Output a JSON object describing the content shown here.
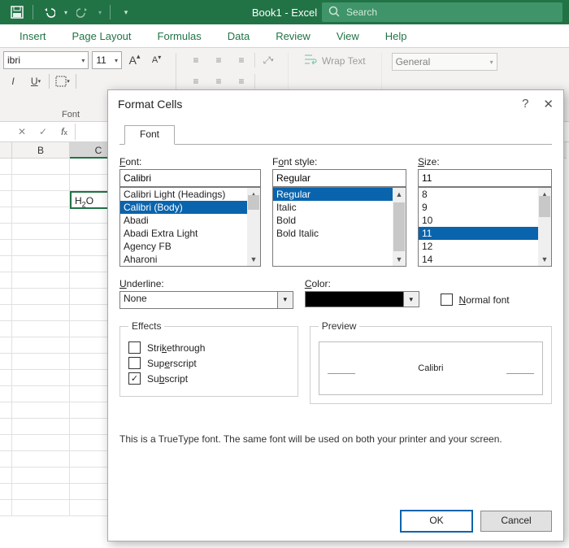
{
  "titlebar": {
    "title": "Book1  -  Excel",
    "search_placeholder": "Search"
  },
  "ribbon": {
    "tabs": [
      "Insert",
      "Page Layout",
      "Formulas",
      "Data",
      "Review",
      "View",
      "Help"
    ],
    "font_name": "ibri",
    "font_size": "11",
    "group_label": "Font",
    "wrap_label": "Wrap Text",
    "number_format": "General"
  },
  "grid": {
    "col_b": "B",
    "col_c": "C",
    "cell_c3_main": "H",
    "cell_c3_sub": "2",
    "cell_c3_tail": "O"
  },
  "dialog": {
    "title": "Format Cells",
    "tab": "Font",
    "font_label": "Font:",
    "font_value": "Calibri",
    "font_list": [
      "Calibri Light (Headings)",
      "Calibri (Body)",
      "Abadi",
      "Abadi Extra Light",
      "Agency FB",
      "Aharoni"
    ],
    "font_selected_index": 1,
    "style_label": "Font style:",
    "style_value": "Regular",
    "style_list": [
      "Regular",
      "Italic",
      "Bold",
      "Bold Italic"
    ],
    "style_selected_index": 0,
    "size_label": "Size:",
    "size_value": "11",
    "size_list": [
      "8",
      "9",
      "10",
      "11",
      "12",
      "14"
    ],
    "size_selected_index": 3,
    "underline_label": "Underline:",
    "underline_value": "None",
    "color_label": "Color:",
    "normalfont_label": "Normal font",
    "effects_legend": "Effects",
    "strike": "Strikethrough",
    "superscript": "Superscript",
    "subscript": "Subscript",
    "subscript_checked": true,
    "preview_legend": "Preview",
    "preview_text": "Calibri",
    "footnote": "This is a TrueType font.  The same font will be used on both your printer and your screen.",
    "ok": "OK",
    "cancel": "Cancel"
  }
}
